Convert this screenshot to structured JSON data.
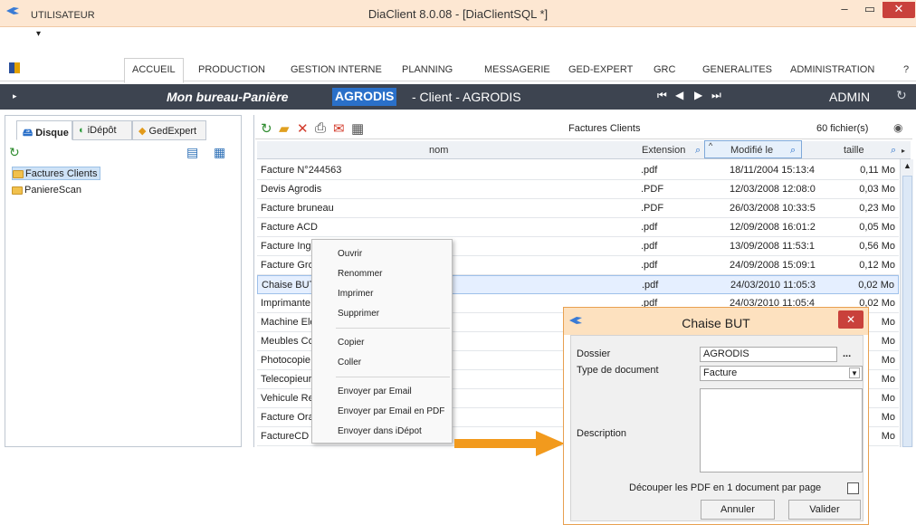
{
  "window": {
    "title": "DiaClient 8.0.08 - [DiaClientSQL *]",
    "minimize_icon": "minimize-icon",
    "maximize_icon": "maximize-icon",
    "close_icon": "close-icon",
    "close_color": "#c9413b"
  },
  "qat": {
    "dropdown_glyph": "▾"
  },
  "menu": {
    "items": [
      "UTILISATEUR",
      "ACCUEIL",
      "PRODUCTION",
      "GESTION INTERNE",
      "PLANNING",
      "MESSAGERIE",
      "GED-EXPERT",
      "GRC",
      "GENERALITES",
      "ADMINISTRATION",
      "?"
    ],
    "active": "ACCUEIL"
  },
  "nav": {
    "title": "Mon bureau-Panière",
    "client_code": "AGRODIS",
    "client_label": "- Client - AGRODIS",
    "user": "ADMIN",
    "accent": "#2a70c9"
  },
  "left": {
    "tabs": [
      "Disque",
      "iDépôt",
      "GedExpert"
    ],
    "active_tab": "Disque",
    "folders": [
      "Factures Clients",
      "PaniereScan"
    ],
    "selected_folder": "Factures Clients"
  },
  "right": {
    "folder_title": "Factures Clients",
    "file_count": "60 fichier(s)",
    "columns": {
      "name": "nom",
      "ext": "Extension",
      "modified": "Modifié le",
      "size": "taille"
    },
    "rows": [
      {
        "name": "Facture N°244563",
        "ext": ".pdf",
        "modified": "18/11/2004 15:13:4",
        "size": "0,11 Mo"
      },
      {
        "name": "Devis Agrodis",
        "ext": ".PDF",
        "modified": "12/03/2008 12:08:0",
        "size": "0,03 Mo"
      },
      {
        "name": "Facture bruneau",
        "ext": ".PDF",
        "modified": "26/03/2008 10:33:5",
        "size": "0,23 Mo"
      },
      {
        "name": "Facture ACD",
        "ext": ".pdf",
        "modified": "12/09/2008 16:01:2",
        "size": "0,05 Mo"
      },
      {
        "name": "Facture Ing",
        "ext": ".pdf",
        "modified": "13/09/2008 11:53:1",
        "size": "0,56 Mo"
      },
      {
        "name": "Facture Gro",
        "ext": ".pdf",
        "modified": "24/09/2008 15:09:1",
        "size": "0,12 Mo"
      },
      {
        "name": "Chaise BUT",
        "ext": ".pdf",
        "modified": "24/03/2010 11:05:3",
        "size": "0,02 Mo"
      },
      {
        "name": "Imprimante",
        "ext": ".pdf",
        "modified": "24/03/2010 11:05:4",
        "size": "0,02 Mo"
      },
      {
        "name": "Machine Elé",
        "ext": "",
        "modified": "",
        "size": "Mo"
      },
      {
        "name": "Meubles Co",
        "ext": "",
        "modified": "",
        "size": "Mo"
      },
      {
        "name": "Photocopie",
        "ext": "",
        "modified": "",
        "size": "Mo"
      },
      {
        "name": "Telecopieur",
        "ext": "",
        "modified": "",
        "size": "Mo"
      },
      {
        "name": "Vehicule Re",
        "ext": "",
        "modified": "",
        "size": "Mo"
      },
      {
        "name": "Facture Ora",
        "ext": "",
        "modified": "",
        "size": "Mo"
      },
      {
        "name": "FactureCD",
        "ext": "",
        "modified": "",
        "size": "Mo"
      }
    ],
    "selected_row": "Chaise BUT"
  },
  "context_menu": {
    "group1": [
      "Ouvrir",
      "Renommer",
      "Imprimer",
      "Supprimer"
    ],
    "group2": [
      "Copier",
      "Coller"
    ],
    "group3": [
      "Envoyer par Email",
      "Envoyer par Email en PDF",
      "Envoyer dans iDépot"
    ]
  },
  "dialog": {
    "title": "Chaise BUT",
    "folder_label": "Dossier",
    "folder_value": "AGRODIS",
    "browse": "...",
    "type_label": "Type de document",
    "type_value": "Facture",
    "description_label": "Description",
    "description_value": "",
    "split_label": "Découper les PDF en 1 document par page",
    "cancel": "Annuler",
    "validate": "Valider"
  },
  "colors": {
    "titlebar": "#fde7d2",
    "navbar": "#3d4450",
    "arrow": "#f29a1d",
    "selection": "#e5efff"
  }
}
